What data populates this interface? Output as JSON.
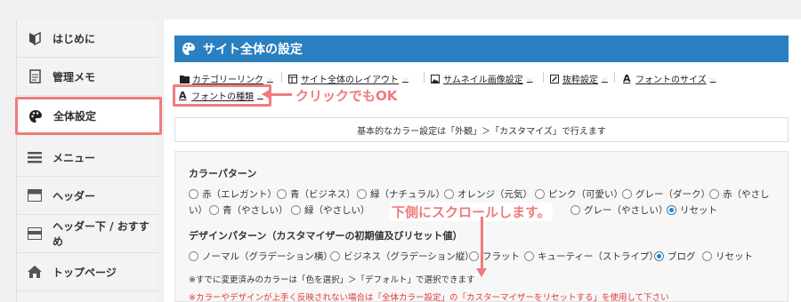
{
  "sidebar": {
    "items": [
      {
        "label": "はじめに",
        "icon": "beginner-icon"
      },
      {
        "label": "管理メモ",
        "icon": "memo-icon"
      },
      {
        "label": "全体設定",
        "icon": "palette-icon",
        "active": true
      },
      {
        "label": "メニュー",
        "icon": "menu-icon"
      },
      {
        "label": "ヘッダー",
        "icon": "header-icon"
      },
      {
        "label": "ヘッダー下 / おすすめ",
        "icon": "header-below-icon"
      },
      {
        "label": "トップページ",
        "icon": "home-icon"
      }
    ]
  },
  "main": {
    "title": "サイト全体の設定",
    "tabs": [
      {
        "label": "カテゴリーリンク",
        "icon": "folder-icon"
      },
      {
        "label": "サイト全体のレイアウト",
        "icon": "layout-icon"
      },
      {
        "label": "サムネイル画像設定",
        "icon": "image-icon"
      },
      {
        "label": "抜粋設定",
        "icon": "excerpt-icon"
      },
      {
        "label": "フォントのサイズ",
        "icon": "font-icon"
      },
      {
        "label": "フォントの種類",
        "icon": "font-icon"
      }
    ],
    "info": "基本的なカラー設定は「外観」＞「カスタマイズ」で行えます"
  },
  "color_pattern": {
    "title": "カラーパターン",
    "row1": [
      "赤（エレガント）",
      "青（ビジネス）",
      "緑（ナチュラル）",
      "オレンジ（元気）",
      "ピンク（可愛い）",
      "グレー（ダーク）",
      "赤（やさし"
    ],
    "row2_prefix": "い）",
    "row2": [
      "青（やさしい）",
      "緑（やさしい）",
      "グレー（やさしい）",
      "リセット"
    ],
    "selected": "リセット"
  },
  "design_pattern": {
    "title": "デザインパターン（カスタマイザーの初期値及びリセット値）",
    "options": [
      "ノーマル（グラデーション横）",
      "ビジネス（グラデーション縦）",
      "フラット",
      "キューティー（ストライプ）",
      "ブログ",
      "リセット"
    ],
    "selected": "ブログ"
  },
  "notes": {
    "note1": "※すでに変更済みのカラーは「色を選択」＞「デフォルト」で選択できます",
    "note2": "※カラーやデザインが上手く反映されない場合は「全体カラー設定」の「カスターマイザーをリセットする」を使用して下さい"
  },
  "annotations": {
    "click_callout": "クリックでもOK",
    "scroll_callout": "下側にスクロールします。",
    "color": "#f07b7b"
  },
  "colors": {
    "accent": "#2a7fc0",
    "highlight": "#f07b7b"
  }
}
